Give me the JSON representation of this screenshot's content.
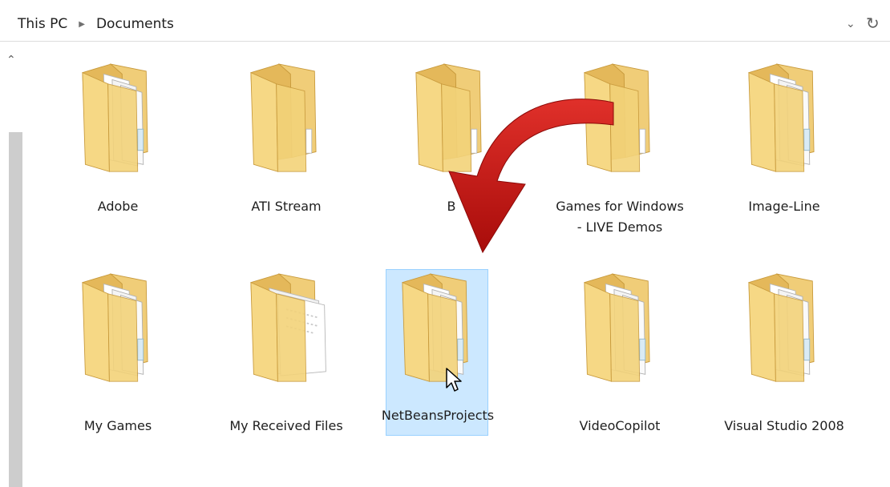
{
  "address_bar": {
    "crumbs": [
      "This PC",
      "Documents"
    ],
    "separator_icon": "chevron-right-icon",
    "dropdown_icon": "chevron-down-icon",
    "refresh_icon": "refresh-icon"
  },
  "folders": [
    {
      "label": "Adobe",
      "variant": "papers"
    },
    {
      "label": "ATI Stream",
      "variant": "plain"
    },
    {
      "label": "B",
      "variant": "plain"
    },
    {
      "label": "Games for Windows - LIVE Demos",
      "variant": "plain"
    },
    {
      "label": "Image-Line",
      "variant": "papers"
    },
    {
      "label": "My Games",
      "variant": "papers"
    },
    {
      "label": "My Received Files",
      "variant": "document"
    },
    {
      "label": "NetBeansProjects",
      "variant": "papers",
      "selected": true
    },
    {
      "label": "VideoCopilot",
      "variant": "papers"
    },
    {
      "label": "Visual Studio 2008",
      "variant": "papers"
    }
  ],
  "colors": {
    "selection_fill": "#cce8ff",
    "selection_border": "#99d1ff",
    "folder_yellow": "#f3d37a",
    "arrow_red": "#c8120f"
  }
}
